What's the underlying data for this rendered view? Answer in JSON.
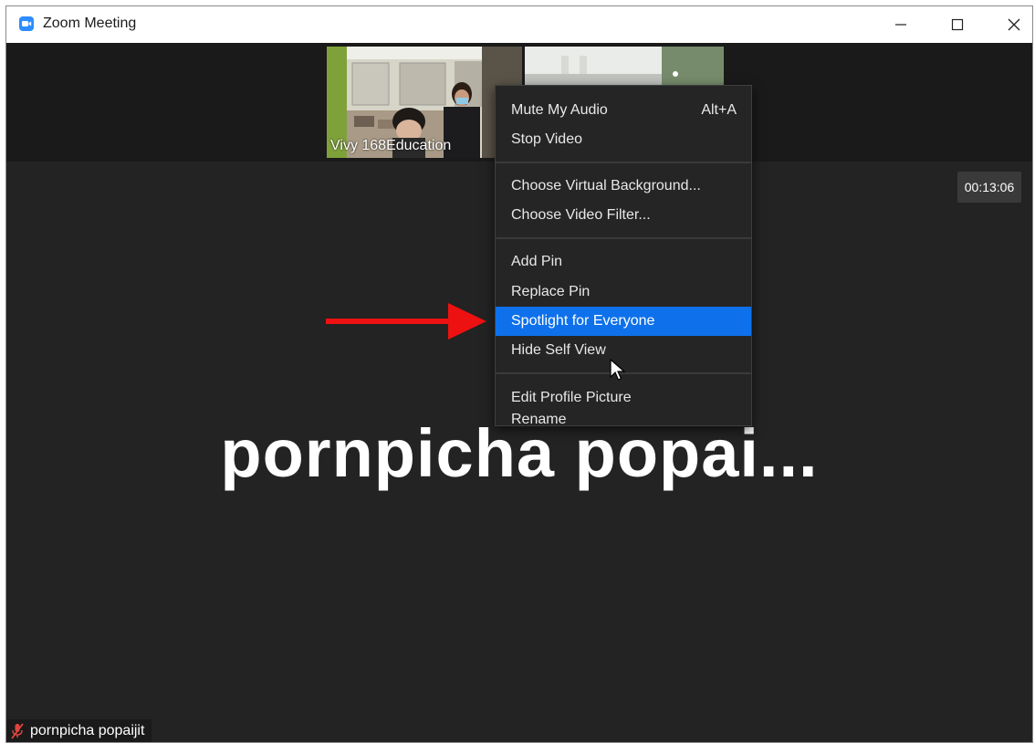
{
  "window": {
    "title": "Zoom Meeting",
    "icon": "zoom-camera-icon",
    "controls": [
      "minimize-icon",
      "maximize-icon",
      "close-icon"
    ]
  },
  "thumbnails": [
    {
      "name": "Vivy 168Education"
    },
    {
      "name": ""
    }
  ],
  "timer": "00:13:06",
  "main_view": {
    "display_name": "pornpicha  popai..."
  },
  "bottom_label": {
    "icon": "muted-mic-icon",
    "name": "pornpicha popaijit"
  },
  "context_menu": {
    "items": [
      {
        "label": "Mute My Audio",
        "shortcut": "Alt+A"
      },
      {
        "label": "Stop Video"
      },
      {
        "label": "Choose Virtual Background..."
      },
      {
        "label": "Choose Video Filter..."
      },
      {
        "label": "Add Pin"
      },
      {
        "label": "Replace Pin"
      },
      {
        "label": "Spotlight for Everyone",
        "highlighted": true
      },
      {
        "label": "Hide Self View"
      },
      {
        "label": "Edit Profile Picture"
      },
      {
        "label": "Rename"
      }
    ]
  },
  "annotation": {
    "icon": "red-arrow-icon",
    "color": "#ee1111"
  },
  "colors": {
    "accent": "#0e71eb",
    "zoom_blue": "#2D8CFF",
    "background": "#232323",
    "menu_bg": "#252525"
  }
}
